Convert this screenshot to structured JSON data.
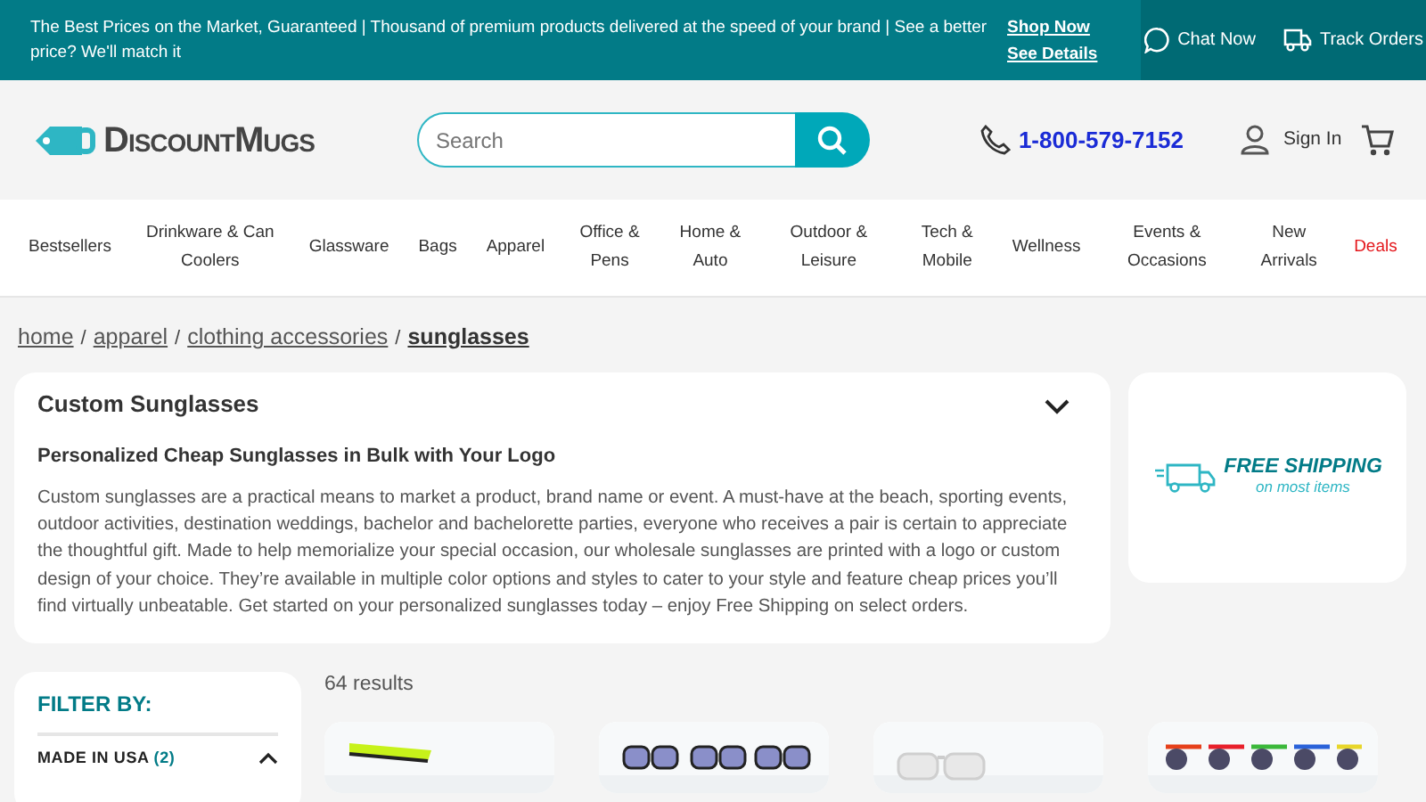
{
  "promo_bar": {
    "text": "The Best Prices on the Market, Guaranteed | Thousand of premium products delivered at the speed of your brand | See a better price? We'll match it",
    "links": [
      "Shop Now",
      "See Details"
    ],
    "actions": [
      "Chat Now",
      "Track Orders"
    ]
  },
  "header": {
    "logo": "DiscountMugs",
    "search": {
      "placeholder": "Search"
    },
    "phone": "1-800-579-7152",
    "sign_in": "Sign In"
  },
  "nav": [
    {
      "label": "Bestsellers",
      "kind": "normal"
    },
    {
      "label": "Drinkware & Can Coolers",
      "kind": "normal"
    },
    {
      "label": "Glassware",
      "kind": "normal"
    },
    {
      "label": "Bags",
      "kind": "normal"
    },
    {
      "label": "Apparel",
      "kind": "normal"
    },
    {
      "label": "Office & Pens",
      "kind": "normal"
    },
    {
      "label": "Home & Auto",
      "kind": "normal"
    },
    {
      "label": "Outdoor & Leisure",
      "kind": "normal"
    },
    {
      "label": "Tech & Mobile",
      "kind": "normal"
    },
    {
      "label": "Wellness",
      "kind": "normal"
    },
    {
      "label": "Events & Occasions",
      "kind": "normal"
    },
    {
      "label": "New Arrivals",
      "kind": "normal"
    },
    {
      "label": "Deals",
      "kind": "deal"
    }
  ],
  "breadcrumb": [
    {
      "label": "home",
      "selected": false
    },
    {
      "separator": "/",
      "label": "apparel",
      "selected": false
    },
    {
      "separator": "/",
      "label": "clothing accessories",
      "selected": false
    },
    {
      "separator": "/",
      "label": "sunglasses",
      "selected": true
    }
  ],
  "description": {
    "title": "Custom Sunglasses",
    "heading": "Personalized Cheap Sunglasses in Bulk with Your Logo",
    "body": "Custom sunglasses are a practical means to market a product, brand name or event. A must-have at the beach, sporting events, outdoor activities, destination weddings, bachelor and bachelorette parties, everyone who receives a pair is certain to appreciate the thoughtful gift. Made to help memorialize your special occasion, our wholesale sunglasses are printed with a logo or custom design of your choice. They’re available in multiple color options and styles to cater to your style and feature cheap prices you’ll find virtually unbeatable. Get started on your personalized sunglasses today – enjoy Free Shipping on select orders."
  },
  "shipping_banner": {
    "title": "FREE SHIPPING",
    "subtitle": "on most items"
  },
  "filter": {
    "title": "FILTER BY:",
    "groups": [
      {
        "label": "MADE IN USA",
        "count": "(2)",
        "expanded": true
      }
    ]
  },
  "results": {
    "count": "64 results"
  }
}
